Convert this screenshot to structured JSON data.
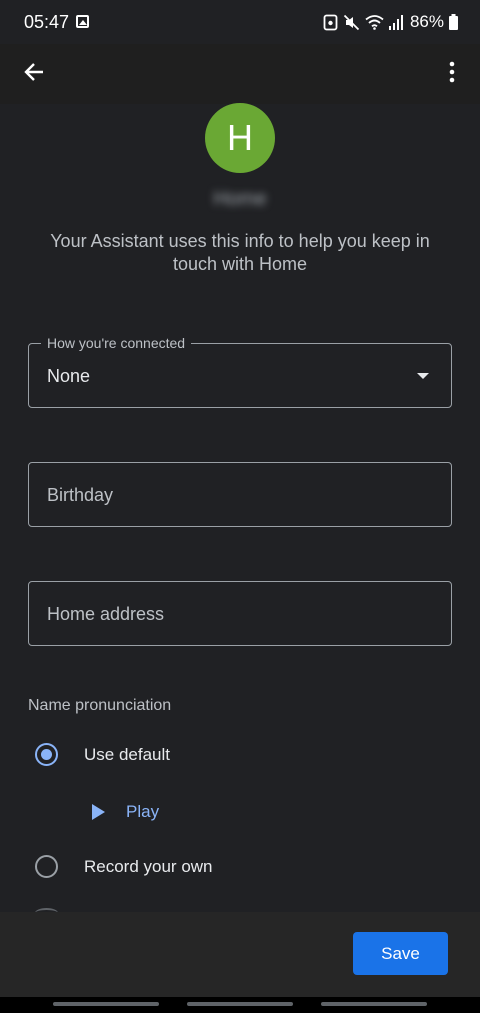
{
  "status_bar": {
    "time": "05:47",
    "battery": "86%",
    "icons": [
      "gallery-icon",
      "lock-icon",
      "mute-icon",
      "wifi-icon",
      "signal-icon",
      "battery-icon"
    ]
  },
  "app_bar": {
    "back_icon": "arrow-back-icon",
    "more_icon": "more-vert-icon"
  },
  "contact": {
    "initial": "H",
    "name": "Home",
    "avatar_color": "#6aa834"
  },
  "helper_text": "Your Assistant uses this info to help you keep in touch with Home",
  "connection": {
    "label": "How you're connected",
    "value": "None"
  },
  "birthday": {
    "placeholder": "Birthday"
  },
  "address": {
    "placeholder": "Home address"
  },
  "pronunciation": {
    "title": "Name pronunciation",
    "options": [
      {
        "label": "Use default",
        "selected": true
      },
      {
        "label": "Record your own",
        "selected": false
      }
    ],
    "play_label": "Play"
  },
  "footer": {
    "save_label": "Save"
  },
  "colors": {
    "accent": "#8ab4f8",
    "primary_button": "#1a73e8",
    "background": "#202124"
  }
}
